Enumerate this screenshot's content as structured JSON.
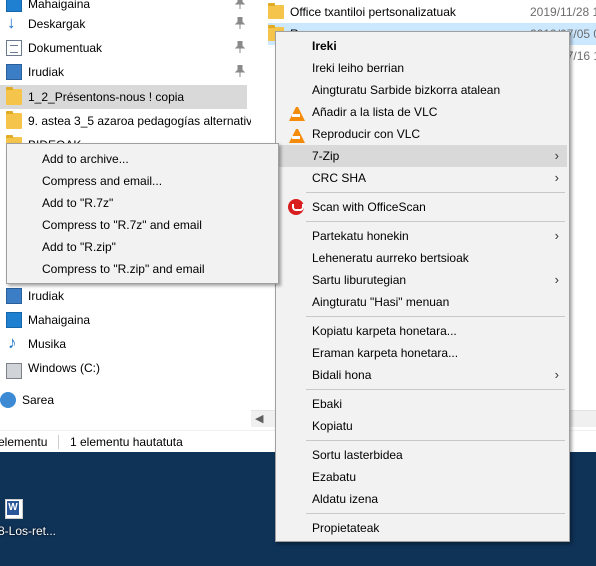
{
  "nav_pane": {
    "items": [
      {
        "label": "Mahaigaina",
        "icon": "desktop-icon",
        "pinned": true
      },
      {
        "label": "Deskargak",
        "icon": "download-icon",
        "pinned": true
      },
      {
        "label": "Dokumentuak",
        "icon": "document-icon",
        "pinned": true
      },
      {
        "label": "Irudiak",
        "icon": "pictures-icon",
        "pinned": true
      },
      {
        "label": "1_2_Présentons-nous ! copia",
        "icon": "folder-icon"
      },
      {
        "label": "9. astea 3_5 azaroa pedagogías alternativas",
        "icon": "folder-icon"
      },
      {
        "label": "BIDEOAK",
        "icon": "folder-icon"
      },
      {
        "label": "Irudiak",
        "icon": "pictures-icon"
      },
      {
        "label": "Mahaigaina",
        "icon": "desktop-icon"
      },
      {
        "label": "Musika",
        "icon": "music-icon"
      },
      {
        "label": "Windows (C:)",
        "icon": "drive-icon"
      },
      {
        "label": "Sarea",
        "icon": "network-icon"
      }
    ]
  },
  "files_pane": {
    "rows": [
      {
        "name": "Office txantiloi pertsonalizatuak",
        "date": "2019/11/28 1"
      },
      {
        "name": "R",
        "date": "2019/07/05 0"
      },
      {
        "name": "",
        "date": "2019/07/16 1"
      }
    ]
  },
  "status_bar": {
    "count": "elementu",
    "selected": "1 elementu hautatuta"
  },
  "desktop": {
    "icon_label": "8-Los-ret..."
  },
  "context_menu": {
    "items": [
      {
        "label": "Ireki",
        "bold": true
      },
      {
        "label": "Ireki leiho berrian"
      },
      {
        "label": "Aingturatu Sarbide bizkorra atalean"
      },
      {
        "label": "Añadir a la lista de VLC",
        "icon": "vlc-icon"
      },
      {
        "label": "Reproducir con VLC",
        "icon": "vlc-icon"
      },
      {
        "label": "7-Zip",
        "submenu": true
      },
      {
        "label": "CRC SHA",
        "submenu": true
      },
      {
        "label": "Scan with OfficeScan",
        "icon": "officescan-icon"
      },
      {
        "label": "Partekatu honekin",
        "submenu": true
      },
      {
        "label": "Leheneratu aurreko bertsioak"
      },
      {
        "label": "Sartu liburutegian",
        "submenu": true
      },
      {
        "label": "Aingturatu \"Hasi\" menuan"
      },
      {
        "label": "Kopiatu karpeta honetara..."
      },
      {
        "label": "Eraman karpeta honetara..."
      },
      {
        "label": "Bidali hona",
        "submenu": true
      },
      {
        "label": "Ebaki"
      },
      {
        "label": "Kopiatu"
      },
      {
        "label": "Sortu lasterbidea"
      },
      {
        "label": "Ezabatu"
      },
      {
        "label": "Aldatu izena"
      },
      {
        "label": "Propietateak"
      }
    ],
    "chevron": "›"
  },
  "zip_submenu": {
    "items": [
      {
        "label": "Add to archive..."
      },
      {
        "label": "Compress and email..."
      },
      {
        "label": "Add to \"R.7z\""
      },
      {
        "label": "Compress to \"R.7z\" and email"
      },
      {
        "label": "Add to \"R.zip\""
      },
      {
        "label": "Compress to \"R.zip\" and email"
      }
    ]
  },
  "colors": {
    "selection": "#cce8ff",
    "menu_bg": "#f2f2f2",
    "menu_hover": "#d9d9d9",
    "desktop_bg": "#0f3257"
  }
}
